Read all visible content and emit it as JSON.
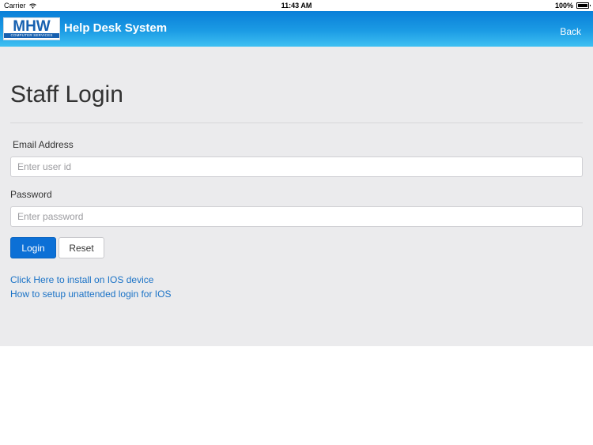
{
  "status_bar": {
    "carrier": "Carrier",
    "time": "11:43 AM",
    "battery": "100%"
  },
  "header": {
    "logo_text": "MHW",
    "logo_subtext": "COMPUTER SERVICES",
    "title": "Help Desk System",
    "back_label": "Back"
  },
  "login": {
    "title": "Staff Login",
    "email_label": "Email Address",
    "email_placeholder": "Enter user id",
    "password_label": "Password",
    "password_placeholder": "Enter password",
    "login_button": "Login",
    "reset_button": "Reset"
  },
  "links": {
    "install_ios": "Click Here to install on IOS device",
    "unattended_login": "How to setup unattended login for IOS"
  },
  "colors": {
    "header_gradient_top": "#0a7fd8",
    "header_gradient_bottom": "#3fc0f2",
    "primary_button": "#0c70d6",
    "link": "#1a72c6",
    "content_bg": "#ebebed"
  }
}
